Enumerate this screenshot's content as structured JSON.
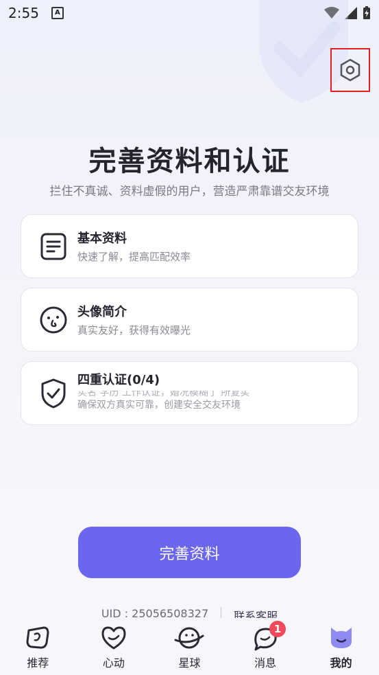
{
  "status_bar": {
    "time": "2:55",
    "a_icon": "A"
  },
  "header": {
    "title": "完善资料和认证",
    "subtitle": "拦住不真诚、资料虚假的用户，营造严肃靠谱交友环境"
  },
  "cards": [
    {
      "title": "基本资料",
      "desc": "快速了解，提高匹配效率",
      "icon": "document-icon"
    },
    {
      "title": "头像简介",
      "desc": "真实友好，获得有效曝光",
      "icon": "face-icon"
    },
    {
      "title": "四重认证(0/4)",
      "desc_top": "实名 学历 工作认证，婚况模糊了 所复实",
      "desc": "确保双方真实可靠，创建安全交友环境",
      "icon": "shield-check-icon"
    }
  ],
  "primary_button": {
    "label": "完善资料"
  },
  "footer": {
    "uid": "UID : 25056508327",
    "contact": "联系客服"
  },
  "tabs": [
    {
      "label": "推荐",
      "icon": "recommend-icon"
    },
    {
      "label": "心动",
      "icon": "heart-icon"
    },
    {
      "label": "星球",
      "icon": "planet-icon"
    },
    {
      "label": "消息",
      "icon": "message-icon",
      "badge": "1"
    },
    {
      "label": "我的",
      "icon": "cat-icon",
      "active": true
    }
  ],
  "colors": {
    "accent": "#6b66ee",
    "badge": "#f04a5a",
    "highlight_box": "#e02020"
  }
}
